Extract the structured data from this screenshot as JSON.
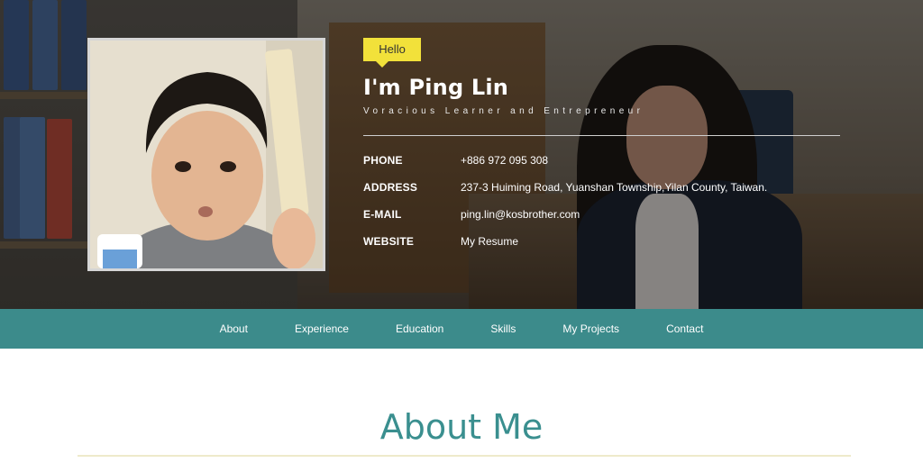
{
  "hero": {
    "greeting": "Hello",
    "name": "I'm Ping Lin",
    "tagline": "Voracious Learner and Entrepreneur",
    "info": [
      {
        "label": "PHONE",
        "value": "+886 972 095 308"
      },
      {
        "label": "ADDRESS",
        "value": "237-3 Huiming Road, Yuanshan Township,Yilan County, Taiwan."
      },
      {
        "label": "E-MAIL",
        "value": "ping.lin@kosbrother.com"
      },
      {
        "label": "WEBSITE",
        "value": "My Resume"
      }
    ]
  },
  "nav": {
    "items": [
      {
        "label": "About"
      },
      {
        "label": "Experience"
      },
      {
        "label": "Education"
      },
      {
        "label": "Skills"
      },
      {
        "label": "My Projects"
      },
      {
        "label": "Contact"
      }
    ]
  },
  "main": {
    "section_title": "About Me"
  },
  "colors": {
    "nav_background": "#3c8b8b",
    "accent_teal": "#3a8f8f",
    "greeting_yellow": "#f2e13a"
  }
}
